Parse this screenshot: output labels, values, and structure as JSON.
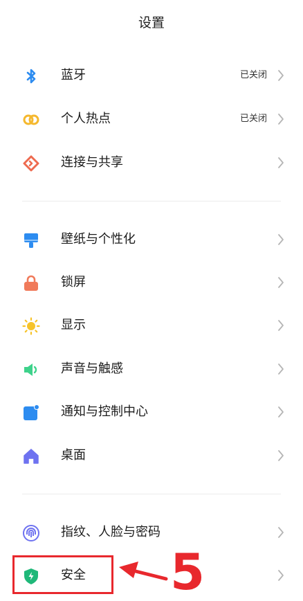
{
  "header": {
    "title": "设置"
  },
  "groups": [
    {
      "items": [
        {
          "label": "蓝牙",
          "status": "已关闭",
          "icon": "bluetooth-icon",
          "color": "#2d8cf0"
        },
        {
          "label": "个人热点",
          "status": "已关闭",
          "icon": "hotspot-icon",
          "color": "#f5b82e"
        },
        {
          "label": "连接与共享",
          "icon": "connection-share-icon",
          "color": "#ee6a4f"
        }
      ]
    },
    {
      "items": [
        {
          "label": "壁纸与个性化",
          "icon": "wallpaper-icon",
          "color": "#2d8cf0"
        },
        {
          "label": "锁屏",
          "icon": "lock-icon",
          "color": "#f07a5a"
        },
        {
          "label": "显示",
          "icon": "sun-icon",
          "color": "#f6c32a"
        },
        {
          "label": "声音与触感",
          "icon": "speaker-icon",
          "color": "#3ed28b"
        },
        {
          "label": "通知与控制中心",
          "icon": "notification-icon",
          "color": "#2d8cf0"
        },
        {
          "label": "桌面",
          "icon": "home-icon",
          "color": "#6e72f0"
        }
      ]
    },
    {
      "items": [
        {
          "label": "指纹、人脸与密码",
          "icon": "fingerprint-icon",
          "color": "#6e72f0"
        },
        {
          "label": "安全",
          "icon": "shield-icon",
          "color": "#1fb879"
        }
      ]
    }
  ],
  "annotation": {
    "number": "5",
    "color": "#e8282d"
  }
}
